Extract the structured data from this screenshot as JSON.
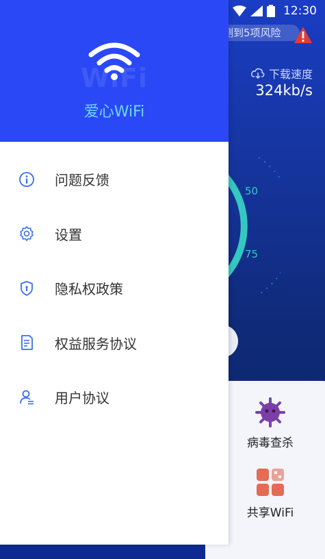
{
  "status_bar": {
    "time": "12:30"
  },
  "background": {
    "risk_banner": "测到5项风险",
    "speed_label": "下载速度",
    "speed_value": "324kb/s",
    "gauge_ticks": [
      "50",
      "75"
    ],
    "tools": [
      {
        "label": "病毒查杀",
        "icon": "virus-icon"
      },
      {
        "label": "共享WiFi",
        "icon": "share-wifi-icon"
      }
    ]
  },
  "drawer": {
    "watermark": "WiFi",
    "app_name": "爱心WiFi",
    "menu": [
      {
        "label": "问题反馈",
        "icon": "info-icon"
      },
      {
        "label": "设置",
        "icon": "gear-icon"
      },
      {
        "label": "隐私权政策",
        "icon": "shield-icon"
      },
      {
        "label": "权益服务协议",
        "icon": "document-icon"
      },
      {
        "label": "用户协议",
        "icon": "user-icon"
      }
    ]
  },
  "colors": {
    "drawer_header": "#2a48f5",
    "app_name": "#6fd8ff",
    "icon_blue": "#3b6cf0",
    "gauge_teal": "#35c8c1"
  }
}
